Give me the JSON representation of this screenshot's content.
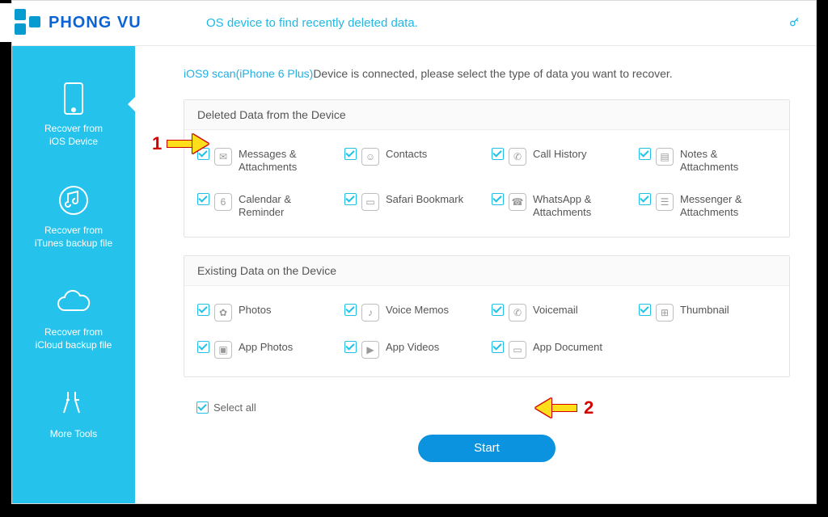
{
  "watermark": {
    "brand": "PHONG VU"
  },
  "topbar": {
    "hint": "OS device to find recently deleted data."
  },
  "crumb": {
    "device": "iOS9 scan(iPhone 6 Plus)",
    "rest": "Device is connected, please select the type of data you want to recover."
  },
  "sidebar": {
    "items": [
      {
        "label": "Recover from\niOS Device",
        "icon": "phone"
      },
      {
        "label": "Recover from\niTunes backup file",
        "icon": "itunes"
      },
      {
        "label": "Recover from\niCloud backup file",
        "icon": "cloud"
      },
      {
        "label": "More Tools",
        "icon": "tools"
      }
    ]
  },
  "panel1": {
    "title": "Deleted Data from the Device",
    "items": [
      {
        "label": "Messages &\nAttachments",
        "glyph": "✉"
      },
      {
        "label": "Contacts",
        "glyph": "☺"
      },
      {
        "label": "Call History",
        "glyph": "✆"
      },
      {
        "label": "Notes &\nAttachments",
        "glyph": "▤"
      },
      {
        "label": "Calendar &\nReminder",
        "glyph": "6"
      },
      {
        "label": "Safari Bookmark",
        "glyph": "▭"
      },
      {
        "label": "WhatsApp &\nAttachments",
        "glyph": "☎"
      },
      {
        "label": "Messenger &\nAttachments",
        "glyph": "☰"
      }
    ]
  },
  "panel2": {
    "title": "Existing Data on the Device",
    "row1": [
      {
        "label": "Photos",
        "glyph": "✿"
      },
      {
        "label": "Voice Memos",
        "glyph": "♪"
      },
      {
        "label": "Voicemail",
        "glyph": "✆"
      },
      {
        "label": "Thumbnail",
        "glyph": "⊞"
      }
    ],
    "row2": [
      {
        "label": "App Photos",
        "glyph": "▣"
      },
      {
        "label": "App Videos",
        "glyph": "▶"
      },
      {
        "label": "App Document",
        "glyph": "▭"
      }
    ]
  },
  "selectall": "Select all",
  "start": "Start",
  "annotations": {
    "one": "1",
    "two": "2"
  }
}
